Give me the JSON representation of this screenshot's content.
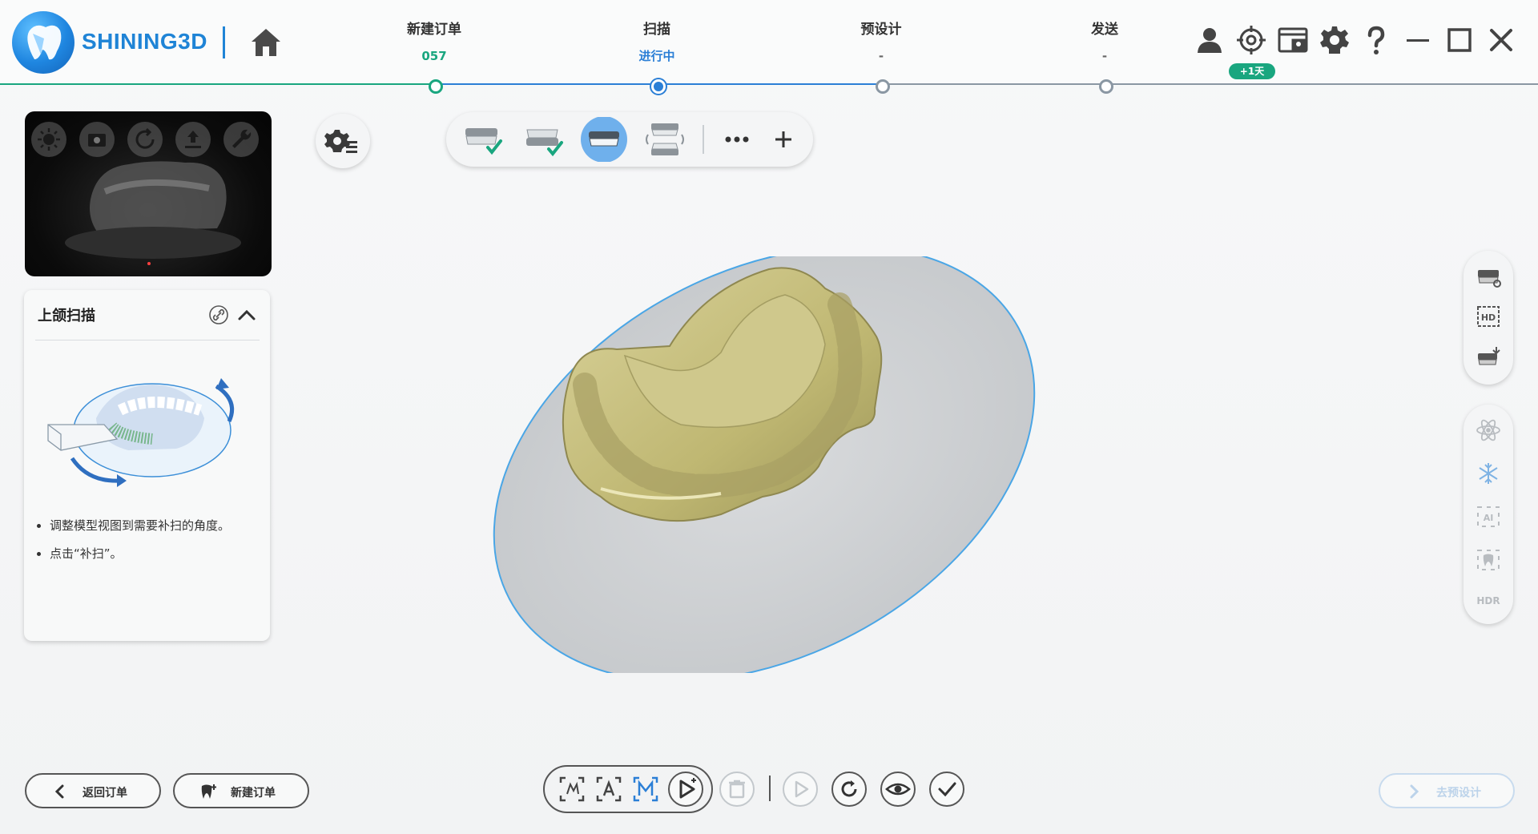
{
  "app": {
    "brand": "SHINING3D"
  },
  "colors": {
    "brand_blue": "#1f84d6",
    "done_green": "#19a67f",
    "current_blue": "#2b7fd6",
    "model_gold": "#c9c27e"
  },
  "steps": [
    {
      "label": "新建订单",
      "value": "057",
      "state": "done"
    },
    {
      "label": "扫描",
      "value": "进行中",
      "state": "current"
    },
    {
      "label": "预设计",
      "value": "-",
      "state": "pending"
    },
    {
      "label": "发送",
      "value": "-",
      "state": "pending"
    }
  ],
  "header_icons": [
    "user-icon",
    "target-icon",
    "screenshot-icon",
    "gear-icon",
    "help-icon",
    "minimize-icon",
    "maximize-icon",
    "close-icon"
  ],
  "badge": {
    "text": "+1天"
  },
  "camera_buttons": [
    "brightness-icon",
    "camera-icon",
    "rotate-icon",
    "upload-icon",
    "wrench-icon"
  ],
  "panel": {
    "title": "上颌扫描",
    "instructions": [
      "调整模型视图到需要补扫的角度。",
      "点击“补扫”。"
    ]
  },
  "toolbar": {
    "items": [
      "upper-jaw-done-icon",
      "lower-jaw-done-icon",
      "upper-jaw-active-icon",
      "bite-icon",
      "more-icon",
      "add-icon"
    ]
  },
  "right_panel_top": [
    "texture-icon",
    "hd-icon",
    "scanner-icon"
  ],
  "right_panel_bottom": [
    "atom-icon",
    "snowflake-icon",
    "ai-icon",
    "tooth-icon",
    "hdr-icon"
  ],
  "right_panel_labels": {
    "hd": "HD",
    "ai": "AI",
    "hdr": "HDR"
  },
  "bottom": {
    "back_label": "返回订单",
    "new_order_label": "新建订单",
    "next_label": "去预设计"
  }
}
